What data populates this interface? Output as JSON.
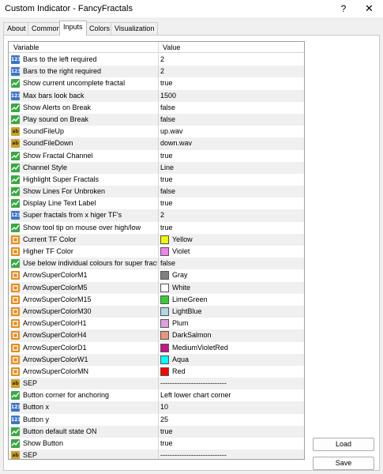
{
  "window": {
    "title": "Custom Indicator - FancyFractals",
    "help_glyph": "?",
    "close_glyph": "✕"
  },
  "tabs": [
    "About",
    "Common",
    "Inputs",
    "Colors",
    "Visualization"
  ],
  "active_tab": "Inputs",
  "grid": {
    "headers": {
      "variable": "Variable",
      "value": "Value"
    },
    "rows": [
      {
        "icon": "int-icon",
        "label": "Bars to the left required",
        "value": "2"
      },
      {
        "icon": "int-icon",
        "label": "Bars to the right required",
        "value": "2"
      },
      {
        "icon": "bool-icon",
        "label": "Show current uncomplete fractal",
        "value": "true"
      },
      {
        "icon": "int-icon",
        "label": "Max bars look back",
        "value": "1500"
      },
      {
        "icon": "bool-icon",
        "label": "Show Alerts on Break",
        "value": "false"
      },
      {
        "icon": "bool-icon",
        "label": "Play sound on Break",
        "value": "false"
      },
      {
        "icon": "string-icon",
        "label": "SoundFileUp",
        "value": "up.wav"
      },
      {
        "icon": "string-icon",
        "label": "SoundFileDown",
        "value": "down.wav"
      },
      {
        "icon": "bool-icon",
        "label": "Show Fractal Channel",
        "value": "true"
      },
      {
        "icon": "enum-icon",
        "label": "Channel Style",
        "value": "Line"
      },
      {
        "icon": "bool-icon",
        "label": "Highlight Super Fractals",
        "value": "true"
      },
      {
        "icon": "bool-icon",
        "label": "Show Lines For Unbroken",
        "value": "false"
      },
      {
        "icon": "bool-icon",
        "label": "Display Line Text Label",
        "value": "true"
      },
      {
        "icon": "int-icon",
        "label": "Super fractals from x higer TF's",
        "value": "2"
      },
      {
        "icon": "bool-icon",
        "label": "Show tool tip on mouse over high/low",
        "value": "true"
      },
      {
        "icon": "color-icon",
        "label": "Current TF Color",
        "value": "Yellow",
        "swatch": "#f5f500"
      },
      {
        "icon": "color-icon",
        "label": "Higher TF Color",
        "value": "Violet",
        "swatch": "#ee82ee"
      },
      {
        "icon": "bool-icon",
        "label": "Use below individual colours for super fractals.",
        "value": "false"
      },
      {
        "icon": "color-icon",
        "label": "ArrowSuperColorM1",
        "value": "Gray",
        "swatch": "#808080"
      },
      {
        "icon": "color-icon",
        "label": "ArrowSuperColorM5",
        "value": "White",
        "swatch": "#ffffff"
      },
      {
        "icon": "color-icon",
        "label": "ArrowSuperColorM15",
        "value": "LimeGreen",
        "swatch": "#32cd32"
      },
      {
        "icon": "color-icon",
        "label": "ArrowSuperColorM30",
        "value": "LightBlue",
        "swatch": "#add8e6"
      },
      {
        "icon": "color-icon",
        "label": "ArrowSuperColorH1",
        "value": "Plum",
        "swatch": "#dda0dd"
      },
      {
        "icon": "color-icon",
        "label": "ArrowSuperColorH4",
        "value": "DarkSalmon",
        "swatch": "#e9967a"
      },
      {
        "icon": "color-icon",
        "label": "ArrowSuperColorD1",
        "value": "MediumVioletRed",
        "swatch": "#c71585"
      },
      {
        "icon": "color-icon",
        "label": "ArrowSuperColorW1",
        "value": "Aqua",
        "swatch": "#00ffff"
      },
      {
        "icon": "color-icon",
        "label": "ArrowSuperColorMN",
        "value": "Red",
        "swatch": "#ff0000"
      },
      {
        "icon": "string-icon",
        "label": "SEP",
        "value": "----------------------------"
      },
      {
        "icon": "enum-icon",
        "label": "Button corner for anchoring",
        "value": "Left lower chart corner"
      },
      {
        "icon": "int-icon",
        "label": "Button x",
        "value": "10"
      },
      {
        "icon": "int-icon",
        "label": "Button y",
        "value": "25"
      },
      {
        "icon": "bool-icon",
        "label": "Button default state ON",
        "value": "true"
      },
      {
        "icon": "bool-icon",
        "label": "Show Button",
        "value": "true"
      },
      {
        "icon": "string-icon",
        "label": "SEP",
        "value": "----------------------------"
      }
    ]
  },
  "buttons": {
    "load": "Load",
    "save": "Save"
  }
}
